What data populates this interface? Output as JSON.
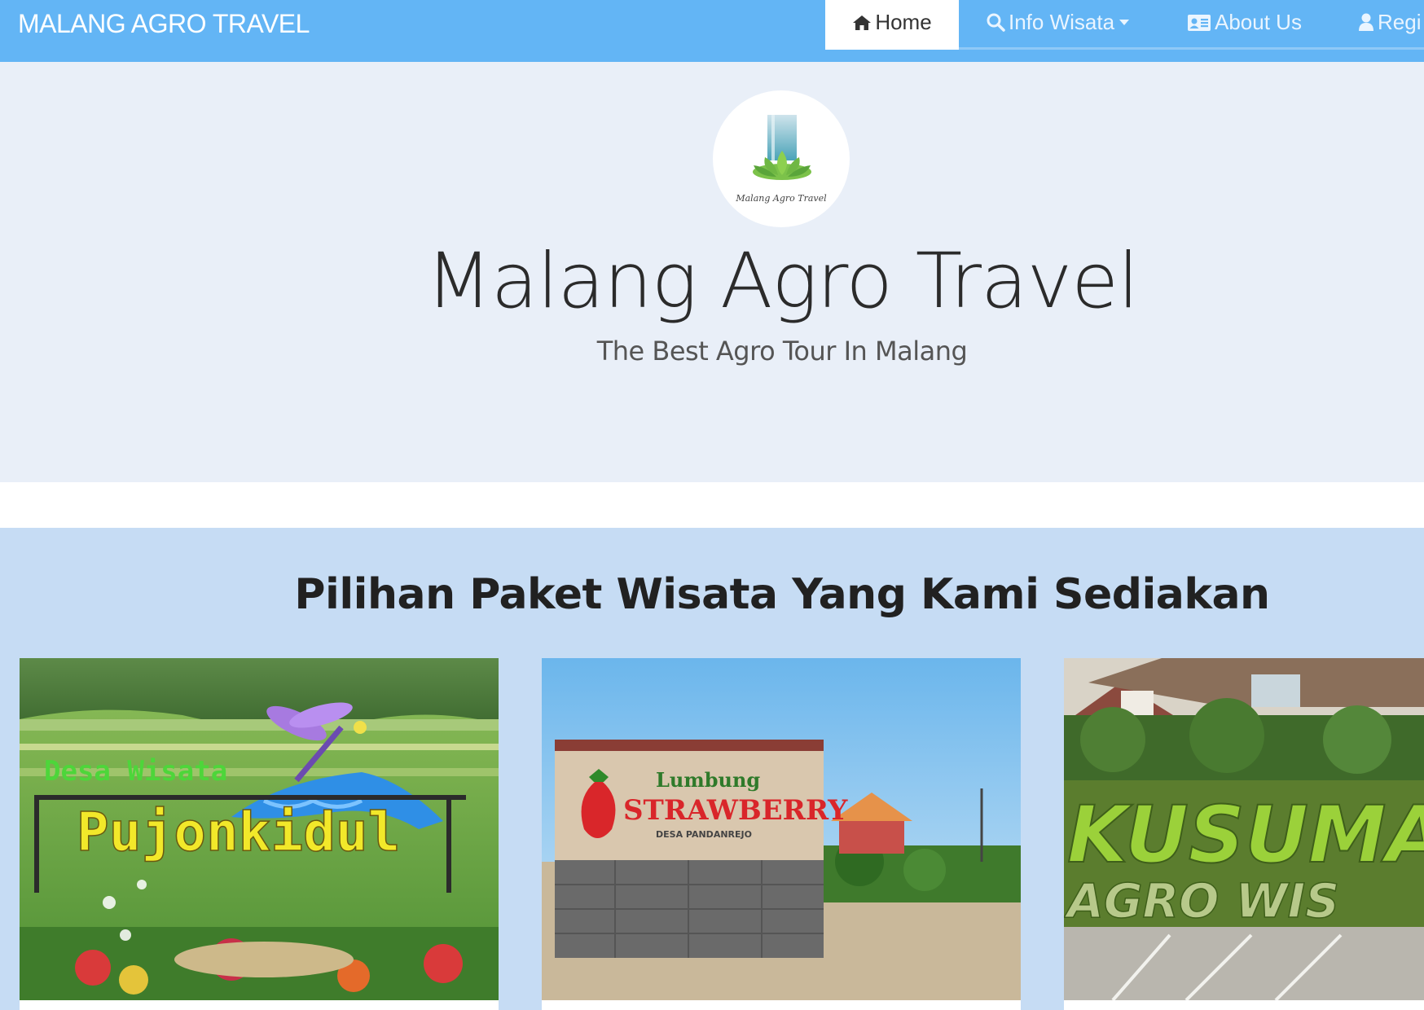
{
  "navbar": {
    "brand": "MALANG AGRO TRAVEL",
    "items": [
      {
        "label": "Home",
        "icon": "home-icon",
        "active": true
      },
      {
        "label": "Info Wisata",
        "icon": "search-icon",
        "dropdown": true
      },
      {
        "label": "About Us",
        "icon": "id-card-icon"
      },
      {
        "label": "Regi",
        "icon": "user-icon"
      }
    ]
  },
  "hero": {
    "logo_caption": "Malang Agro Travel",
    "title": "Malang Agro Travel",
    "subtitle": "The Best Agro Tour In Malang"
  },
  "packages": {
    "title": "Pilihan Paket Wisata Yang Kami Sediakan",
    "cards": [
      {
        "image": "pujonkidul-photo",
        "sign_top": "Desa Wisata",
        "sign_main": "Pujonkidul"
      },
      {
        "image": "lumbung-strawberry-photo",
        "sign_top": "Lumbung",
        "sign_main": "STRAWBERRY",
        "sign_sub": "DESA PANDANREJO"
      },
      {
        "image": "kusuma-agro-photo",
        "sign_main": "KUSUMA",
        "sign_sub": "AGRO WIS"
      }
    ]
  },
  "colors": {
    "navbar": "#63b5f5",
    "hero_bg": "#e9eff8",
    "section_bg": "#c6dcf4"
  }
}
